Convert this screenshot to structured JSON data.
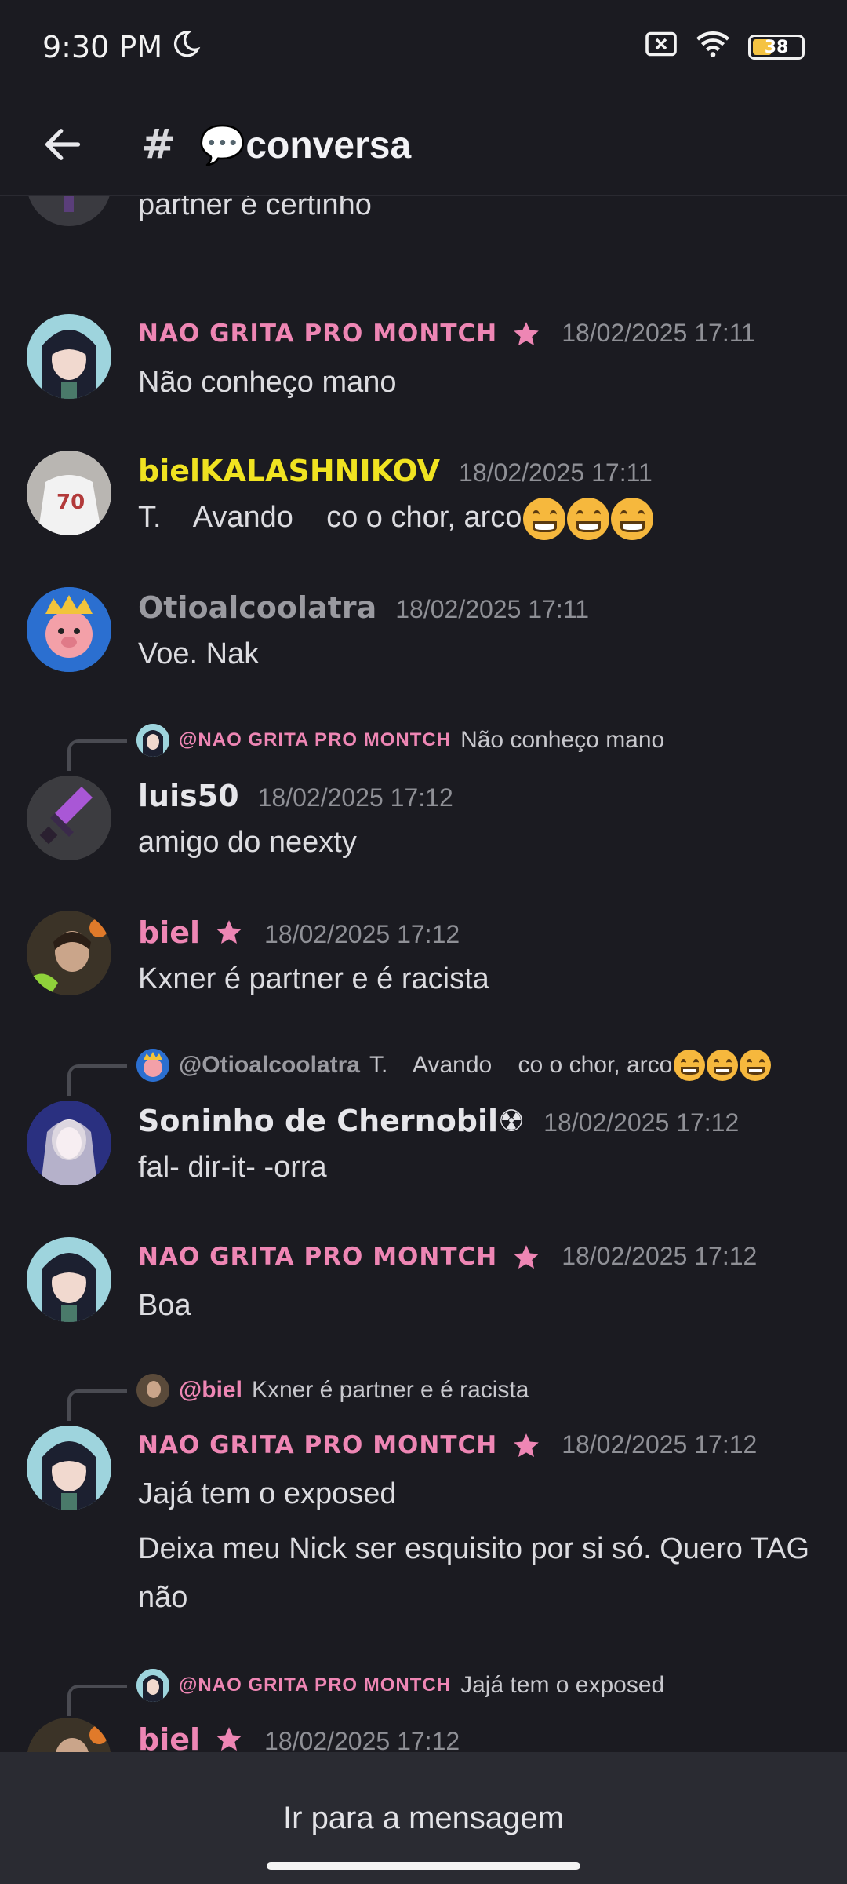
{
  "status": {
    "time": "9:30 PM",
    "battery": "38"
  },
  "header": {
    "channel": "💬conversa"
  },
  "colors": {
    "pink": "#ee86b4",
    "yellow": "#f0e321",
    "gray": "#9a9aa0",
    "white": "#e6e6ea"
  },
  "messages": [
    {
      "text": "vc vê o vireicaixa aí vc percebe que nem todo partner é certinho"
    },
    {
      "name": "NAO GRITA PRO MONTCH",
      "timestamp": "18/02/2025 17:11",
      "text": "Não conheço mano"
    },
    {
      "name": "bielKALASHNIKOV",
      "timestamp": "18/02/2025 17:11",
      "text": "T.    Avando    co o chor, arco"
    },
    {
      "name": "Otioalcoolatra",
      "timestamp": "18/02/2025 17:11",
      "text": "Voe. Nak"
    },
    {
      "reply_name": "@NAO GRITA PRO MONTCH",
      "reply_text": "Não conheço mano",
      "name": "luis50",
      "timestamp": "18/02/2025 17:12",
      "text": "amigo do neexty"
    },
    {
      "name": "biel",
      "timestamp": "18/02/2025 17:12",
      "text": "Kxner é partner e é racista"
    },
    {
      "reply_name": "@Otioalcoolatra",
      "reply_text": "T.    Avando    co o chor, arco",
      "name": "Soninho de Chernobil☢",
      "timestamp": "18/02/2025 17:12",
      "text": "fal- dir-it- -orra"
    },
    {
      "name": "NAO GRITA PRO MONTCH",
      "timestamp": "18/02/2025 17:12",
      "text": "Boa"
    },
    {
      "reply_name": "@biel",
      "reply_text": "Kxner é partner e é racista",
      "name": "NAO GRITA PRO MONTCH",
      "timestamp": "18/02/2025 17:12",
      "text": "Jajá tem o exposed",
      "text2": "Deixa meu Nick ser esquisito por si só. Quero TAG não"
    },
    {
      "reply_name": "@NAO GRITA PRO MONTCH",
      "reply_text": "Jajá tem o exposed",
      "name": "biel",
      "timestamp": "18/02/2025 17:12"
    }
  ],
  "bottom": {
    "jump_label": "Ir para a mensagem"
  }
}
